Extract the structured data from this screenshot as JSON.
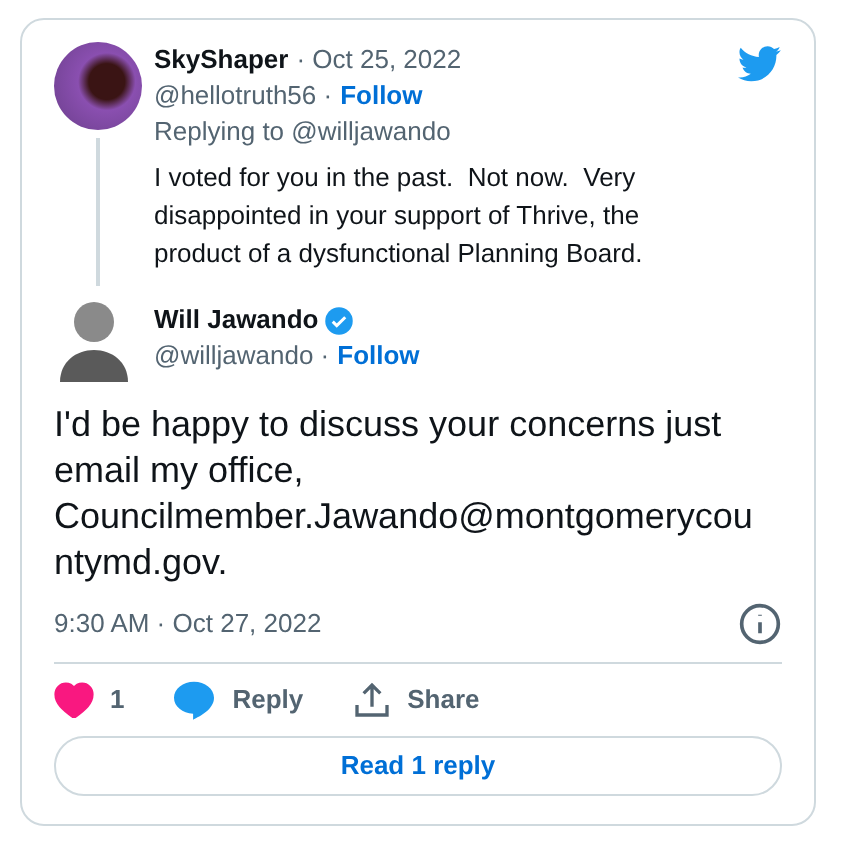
{
  "parent_tweet": {
    "name": "SkyShaper",
    "date": "· Oct 25, 2022",
    "handle": "@hellotruth56 ·",
    "follow": "Follow",
    "replying_to": "Replying to @willjawando",
    "text": "I voted for you in the past.  Not now.  Very disappointed in your support of Thrive, the product of a dysfunctional Planning Board."
  },
  "main_tweet": {
    "name": "Will Jawando",
    "verified": true,
    "handle": "@willjawando ·",
    "follow": "Follow",
    "text": "I'd be happy to discuss your concerns just email my office, Councilmember.Jawando@montgomerycountymd.gov.",
    "timestamp": "9:30 AM · Oct 27, 2022"
  },
  "actions": [
    {
      "kind": "like",
      "label": "1",
      "selected": true
    },
    {
      "kind": "reply",
      "label": "Reply"
    },
    {
      "kind": "share",
      "label": "Share"
    }
  ],
  "read_replies": "Read 1 reply"
}
